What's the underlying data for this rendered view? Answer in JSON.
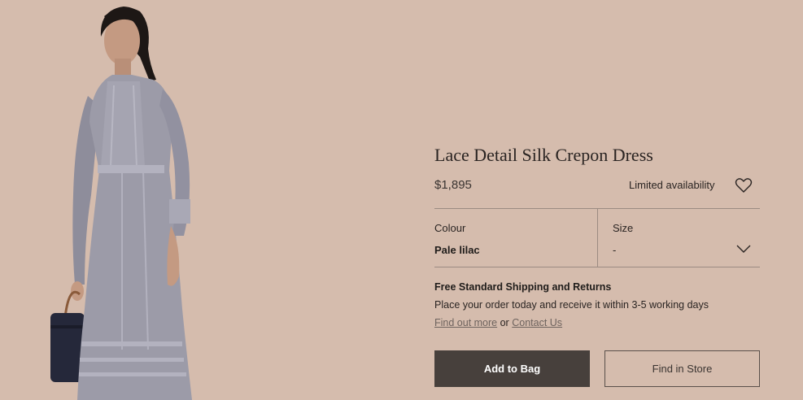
{
  "product": {
    "title": "Lace Detail Silk Crepon Dress",
    "price": "$1,895",
    "availability": "Limited availability"
  },
  "options": {
    "colour_label": "Colour",
    "colour_value": "Pale lilac",
    "size_label": "Size",
    "size_value": "-"
  },
  "shipping": {
    "title": "Free Standard Shipping and Returns",
    "text": "Place your order today and receive it within 3-5 working days",
    "find_out_more": "Find out more",
    "or": "or",
    "contact_us": "Contact Us"
  },
  "actions": {
    "add_to_bag": "Add to Bag",
    "find_in_store": "Find in Store"
  },
  "icons": {
    "wishlist": "heart-icon",
    "size_dropdown": "chevron-down-icon"
  },
  "colors": {
    "background": "#d5bcad",
    "primary_button": "#47403c",
    "dress": "#9c9ba8"
  }
}
